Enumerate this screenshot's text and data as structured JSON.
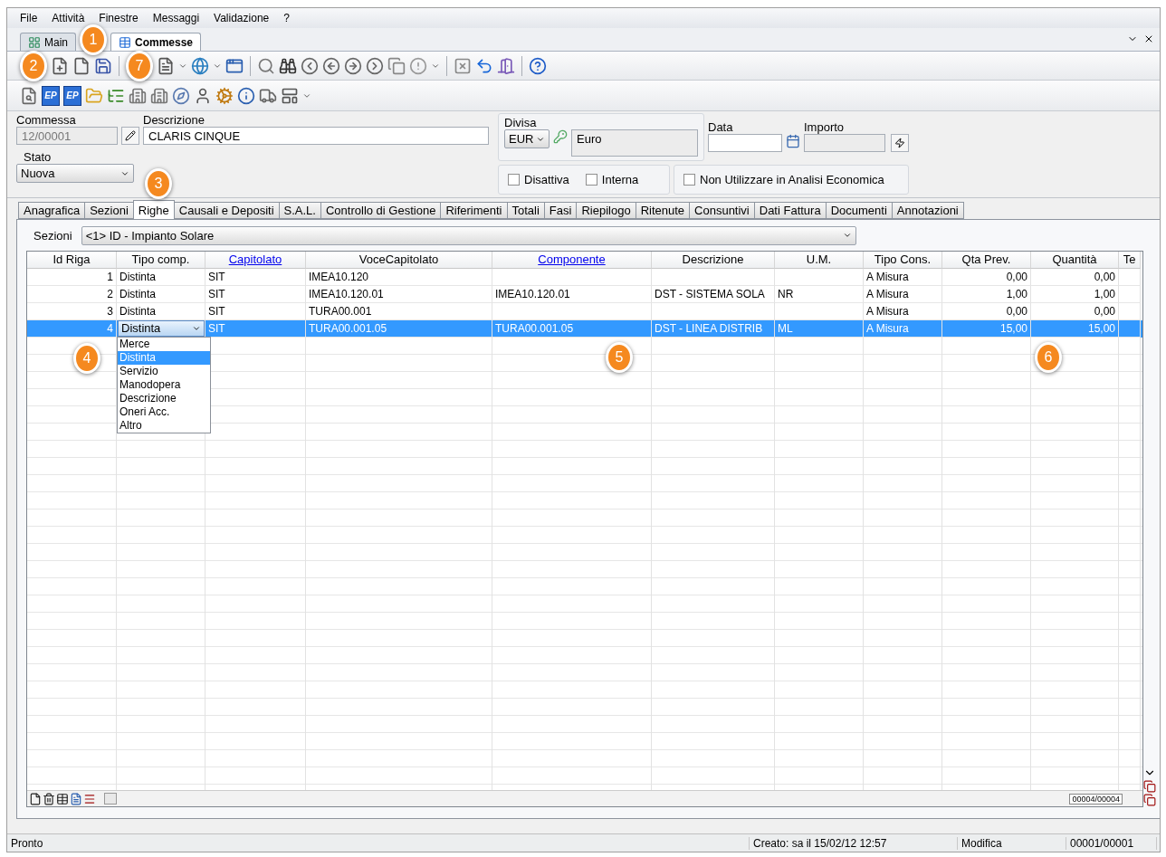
{
  "menu": [
    "File",
    "Attività",
    "Finestre",
    "Messaggi",
    "Validazione",
    "?"
  ],
  "doc_tabs": [
    {
      "label": "Main",
      "selected": false
    },
    {
      "label": "Commesse",
      "selected": true
    }
  ],
  "toolbar2_badges": [
    "EP",
    "EP"
  ],
  "form": {
    "commessa": {
      "label": "Commessa",
      "value": "12/00001"
    },
    "descrizione": {
      "label": "Descrizione",
      "value": "CLARIS CINQUE"
    },
    "stato": {
      "label": "Stato",
      "value": "Nuova"
    },
    "divisa": {
      "label": "Divisa",
      "code": "EUR",
      "name": "Euro"
    },
    "data": {
      "label": "Data"
    },
    "importo": {
      "label": "Importo"
    },
    "checkboxes": [
      {
        "label": "Disattiva",
        "checked": false
      },
      {
        "label": "Interna",
        "checked": false
      },
      {
        "label": "Non Utilizzare in Analisi Economica",
        "checked": false
      }
    ]
  },
  "section_tabs": [
    {
      "label": "Anagrafica",
      "selected": false
    },
    {
      "label": "Sezioni",
      "selected": false
    },
    {
      "label": "Righe",
      "selected": true
    },
    {
      "label": "Causali e Depositi",
      "selected": false
    },
    {
      "label": "S.A.L.",
      "selected": false
    },
    {
      "label": "Controllo di Gestione",
      "selected": false
    },
    {
      "label": "Riferimenti",
      "selected": false
    },
    {
      "label": "Totali",
      "selected": false
    },
    {
      "label": "Fasi",
      "selected": false
    },
    {
      "label": "Riepilogo",
      "selected": false
    },
    {
      "label": "Ritenute",
      "selected": false
    },
    {
      "label": "Consuntivi",
      "selected": false
    },
    {
      "label": "Dati Fattura",
      "selected": false
    },
    {
      "label": "Documenti",
      "selected": false
    },
    {
      "label": "Annotazioni",
      "selected": false
    }
  ],
  "sezioni": {
    "label": "Sezioni",
    "value": "<1> ID - Impianto Solare"
  },
  "grid": {
    "columns": [
      {
        "label": "Id Riga",
        "link": false
      },
      {
        "label": "Tipo comp.",
        "link": false
      },
      {
        "label": "Capitolato",
        "link": true
      },
      {
        "label": "VoceCapitolato",
        "link": false
      },
      {
        "label": "Componente",
        "link": true
      },
      {
        "label": "Descrizione",
        "link": false
      },
      {
        "label": "U.M.",
        "link": false
      },
      {
        "label": "Tipo Cons.",
        "link": false
      },
      {
        "label": "Qta Prev.",
        "link": false
      },
      {
        "label": "Quantità",
        "link": false
      },
      {
        "label": "Te",
        "link": false
      }
    ],
    "rows": [
      {
        "selected": false,
        "cells": [
          "1",
          "Distinta",
          "SIT",
          "IMEA10.120",
          null,
          null,
          null,
          "A Misura",
          "0,00",
          "0,00",
          null
        ]
      },
      {
        "selected": false,
        "cells": [
          "2",
          "Distinta",
          "SIT",
          "IMEA10.120.01",
          "IMEA10.120.01",
          "DST - SISTEMA SOLA",
          "NR",
          "A Misura",
          "1,00",
          "1,00",
          null
        ]
      },
      {
        "selected": false,
        "cells": [
          "3",
          "Distinta",
          "SIT",
          "TURA00.001",
          null,
          null,
          null,
          "A Misura",
          "0,00",
          "0,00",
          null
        ]
      },
      {
        "selected": true,
        "cells": [
          "4",
          "Distinta",
          "SIT",
          "TURA00.001.05",
          "TURA00.001.05",
          "DST - LINEA DISTRIB",
          "ML",
          "A Misura",
          "15,00",
          "15,00",
          null
        ]
      }
    ],
    "dropdown": [
      {
        "label": "Merce",
        "selected": false
      },
      {
        "label": "Distinta",
        "selected": true
      },
      {
        "label": "Servizio",
        "selected": false
      },
      {
        "label": "Manodopera",
        "selected": false
      },
      {
        "label": "Descrizione",
        "selected": false
      },
      {
        "label": "Oneri Acc.",
        "selected": false
      },
      {
        "label": "Altro",
        "selected": false
      }
    ],
    "record_counter": "00004/00004"
  },
  "status_bar": [
    "Pronto",
    "Creato: sa il 15/02/12 12:57",
    "Modifica",
    "00001/00001"
  ],
  "callouts": [
    "1",
    "2",
    "3",
    "4",
    "5",
    "6",
    "7"
  ]
}
